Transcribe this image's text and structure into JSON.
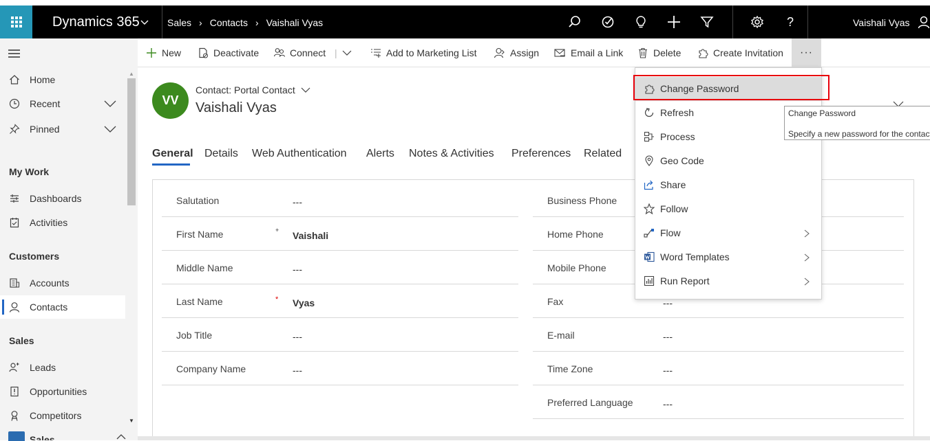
{
  "app": {
    "name": "Dynamics 365"
  },
  "breadcrumb": [
    "Sales",
    "Contacts",
    "Vaishali Vyas"
  ],
  "user": {
    "name": "Vaishali Vyas"
  },
  "topbar_icons": [
    "search-icon",
    "task-icon",
    "lightbulb-icon",
    "plus-icon",
    "filter-icon",
    "settings-icon",
    "help-icon",
    "user-icon"
  ],
  "colors": {
    "accent": "#2266c4",
    "waffle": "#2597b7",
    "avatar": "#3c8a1e",
    "highlight": "#e8000b"
  },
  "commands": {
    "new": "New",
    "deactivate": "Deactivate",
    "connect": "Connect",
    "add_to_marketing_list": "Add to Marketing List",
    "assign": "Assign",
    "email_link": "Email a Link",
    "delete": "Delete",
    "create_invitation": "Create Invitation",
    "more": "···"
  },
  "sidebar": {
    "items": [
      {
        "label": "Home",
        "icon": "home-icon"
      },
      {
        "label": "Recent",
        "icon": "clock-icon"
      },
      {
        "label": "Pinned",
        "icon": "pin-icon"
      }
    ],
    "groups": {
      "my_work": "My Work",
      "customers": "Customers",
      "sales": "Sales"
    },
    "my_work": [
      {
        "label": "Dashboards",
        "icon": "dashboard-icon"
      },
      {
        "label": "Activities",
        "icon": "activities-icon"
      }
    ],
    "customers": [
      {
        "label": "Accounts",
        "icon": "accounts-icon"
      },
      {
        "label": "Contacts",
        "icon": "contact-icon"
      }
    ],
    "sales": [
      {
        "label": "Leads",
        "icon": "leads-icon"
      },
      {
        "label": "Opportunities",
        "icon": "opportunity-icon"
      },
      {
        "label": "Competitors",
        "icon": "competitor-icon"
      }
    ],
    "footer_area_label": "Sales"
  },
  "record": {
    "avatar_initials": "VV",
    "entity_type": "Contact: Portal Contact",
    "name": "Vaishali Vyas"
  },
  "tabs": [
    "General",
    "Details",
    "Web Authentication",
    "Alerts",
    "Notes & Activities",
    "Preferences",
    "Related"
  ],
  "form": {
    "left": [
      {
        "label": "Salutation",
        "value": "---"
      },
      {
        "label": "First Name",
        "value": "Vaishali",
        "marker": "+"
      },
      {
        "label": "Middle Name",
        "value": "---"
      },
      {
        "label": "Last Name",
        "value": "Vyas",
        "marker": "*"
      },
      {
        "label": "Job Title",
        "value": "---"
      },
      {
        "label": "Company Name",
        "value": "---"
      }
    ],
    "right": [
      {
        "label": "Business Phone",
        "value": ""
      },
      {
        "label": "Home Phone",
        "value": ""
      },
      {
        "label": "Mobile Phone",
        "value": ""
      },
      {
        "label": "Fax",
        "value": "---"
      },
      {
        "label": "E-mail",
        "value": "---"
      },
      {
        "label": "Time Zone",
        "value": "---"
      },
      {
        "label": "Preferred Language",
        "value": "---"
      }
    ]
  },
  "more_menu": [
    {
      "label": "Change Password",
      "icon": "puzzle-icon"
    },
    {
      "label": "Refresh",
      "icon": "refresh-icon"
    },
    {
      "label": "Process",
      "icon": "process-icon"
    },
    {
      "label": "Geo Code",
      "icon": "location-icon"
    },
    {
      "label": "Share",
      "icon": "share-icon"
    },
    {
      "label": "Follow",
      "icon": "star-icon"
    },
    {
      "label": "Flow",
      "icon": "flow-icon"
    },
    {
      "label": "Word Templates",
      "icon": "word-icon"
    },
    {
      "label": "Run Report",
      "icon": "report-icon"
    }
  ],
  "tooltip": {
    "title": "Change Password",
    "description": "Specify a new password for the contact"
  }
}
